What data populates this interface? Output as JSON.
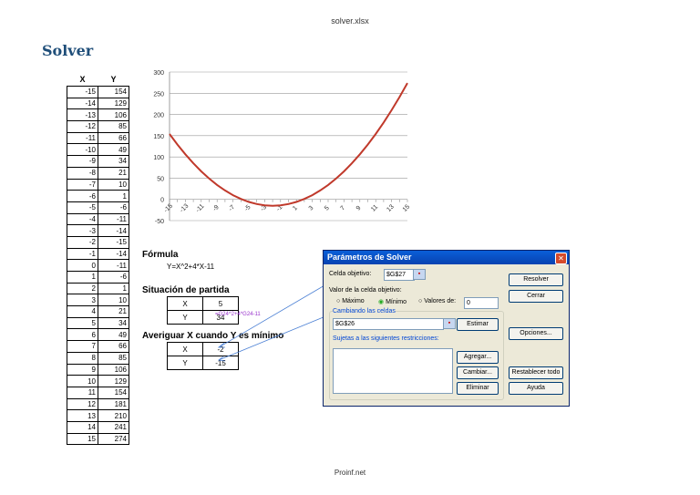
{
  "file_name": "solver.xlsx",
  "title": "Solver",
  "table": {
    "headers": [
      "X",
      "Y"
    ],
    "rows": [
      [
        -15,
        154
      ],
      [
        -14,
        129
      ],
      [
        -13,
        106
      ],
      [
        -12,
        85
      ],
      [
        -11,
        66
      ],
      [
        -10,
        49
      ],
      [
        -9,
        34
      ],
      [
        -8,
        21
      ],
      [
        -7,
        10
      ],
      [
        -6,
        1
      ],
      [
        -5,
        -6
      ],
      [
        -4,
        -11
      ],
      [
        -3,
        -14
      ],
      [
        -2,
        -15
      ],
      [
        -1,
        -14
      ],
      [
        0,
        -11
      ],
      [
        1,
        -6
      ],
      [
        2,
        1
      ],
      [
        3,
        10
      ],
      [
        4,
        21
      ],
      [
        5,
        34
      ],
      [
        6,
        49
      ],
      [
        7,
        66
      ],
      [
        8,
        85
      ],
      [
        9,
        106
      ],
      [
        10,
        129
      ],
      [
        11,
        154
      ],
      [
        12,
        181
      ],
      [
        13,
        210
      ],
      [
        14,
        241
      ],
      [
        15,
        274
      ]
    ]
  },
  "chart_data": {
    "type": "line",
    "title": "",
    "xlabel": "",
    "ylabel": "",
    "xlim": [
      -15,
      15
    ],
    "ylim": [
      -50,
      300
    ],
    "x_ticks": [
      "-15",
      "-13",
      "-11",
      "-9",
      "-7",
      "-5",
      "-3",
      "-1",
      "1",
      "3",
      "5",
      "7",
      "9",
      "11",
      "13",
      "15"
    ],
    "y_ticks": [
      "300",
      "250",
      "200",
      "150",
      "100",
      "50",
      "0",
      "-50"
    ],
    "series": [
      {
        "name": "Y",
        "color": "#c0392b",
        "x": [
          -15,
          -14,
          -13,
          -12,
          -11,
          -10,
          -9,
          -8,
          -7,
          -6,
          -5,
          -4,
          -3,
          -2,
          -1,
          0,
          1,
          2,
          3,
          4,
          5,
          6,
          7,
          8,
          9,
          10,
          11,
          12,
          13,
          14,
          15
        ],
        "y": [
          154,
          129,
          106,
          85,
          66,
          49,
          34,
          21,
          10,
          1,
          -6,
          -11,
          -14,
          -15,
          -14,
          -11,
          -6,
          1,
          10,
          21,
          34,
          49,
          66,
          85,
          106,
          129,
          154,
          181,
          210,
          241,
          274
        ]
      }
    ]
  },
  "formula": {
    "label": "Fórmula",
    "text": "Y=X^2+4*X-11"
  },
  "start": {
    "label": "Situación de partida",
    "x_label": "X",
    "x_value": "5",
    "y_label": "Y",
    "y_value": "34",
    "cell_formula": "=G24^2+4*G24-11"
  },
  "goal": {
    "label": "Averiguar X cuando Y es mínimo",
    "x_label": "X",
    "x_value": "-2",
    "y_label": "Y",
    "y_value": "-15"
  },
  "dialog": {
    "title": "Parámetros de Solver",
    "target_label": "Celda objetivo:",
    "target_value": "$G$27",
    "value_label": "Valor de la celda objetivo:",
    "max_label": "Máximo",
    "min_label": "Mínimo",
    "values_label": "Valores de:",
    "values_value": "0",
    "changing_label": "Cambiando las celdas",
    "changing_value": "$G$26",
    "constraints_label": "Sujetas a las siguientes restricciones:",
    "buttons": {
      "solve": "Resolver",
      "close": "Cerrar",
      "options": "Opciones...",
      "estimate": "Estimar",
      "add": "Agregar...",
      "change": "Cambiar...",
      "delete": "Eliminar",
      "reset": "Restablecer todo",
      "help": "Ayuda"
    }
  },
  "footer": "Proinf.net"
}
